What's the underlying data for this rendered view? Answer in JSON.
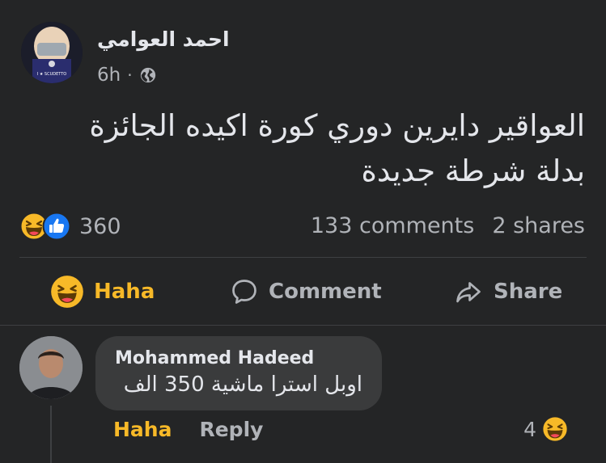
{
  "post": {
    "author": "احمد العوامي",
    "time": "6h",
    "separator": "·",
    "privacy_icon": "globe-icon",
    "text_line1": "العواقير دايرين دوري كورة اكيده الجائزة",
    "text_line2": "بدلة شرطة جديدة",
    "reaction_icons": [
      "haha-icon",
      "like-icon"
    ],
    "reaction_count": "360",
    "comments": "133 comments",
    "shares": "2 shares",
    "avatar_badge": "I ★ SCUDETTO"
  },
  "actions": {
    "haha": "Haha",
    "comment": "Comment",
    "share": "Share"
  },
  "comment": {
    "author": "Mohammed Hadeed",
    "text": "اوبل استرا ماشية 350 الف",
    "haha": "Haha",
    "reply": "Reply",
    "reaction_count": "4"
  },
  "colors": {
    "background": "#242526",
    "text": "#e4e6eb",
    "secondary": "#b0b3b8",
    "haha": "#f7b928",
    "like": "#1877f2",
    "bubble": "#3a3b3c"
  }
}
